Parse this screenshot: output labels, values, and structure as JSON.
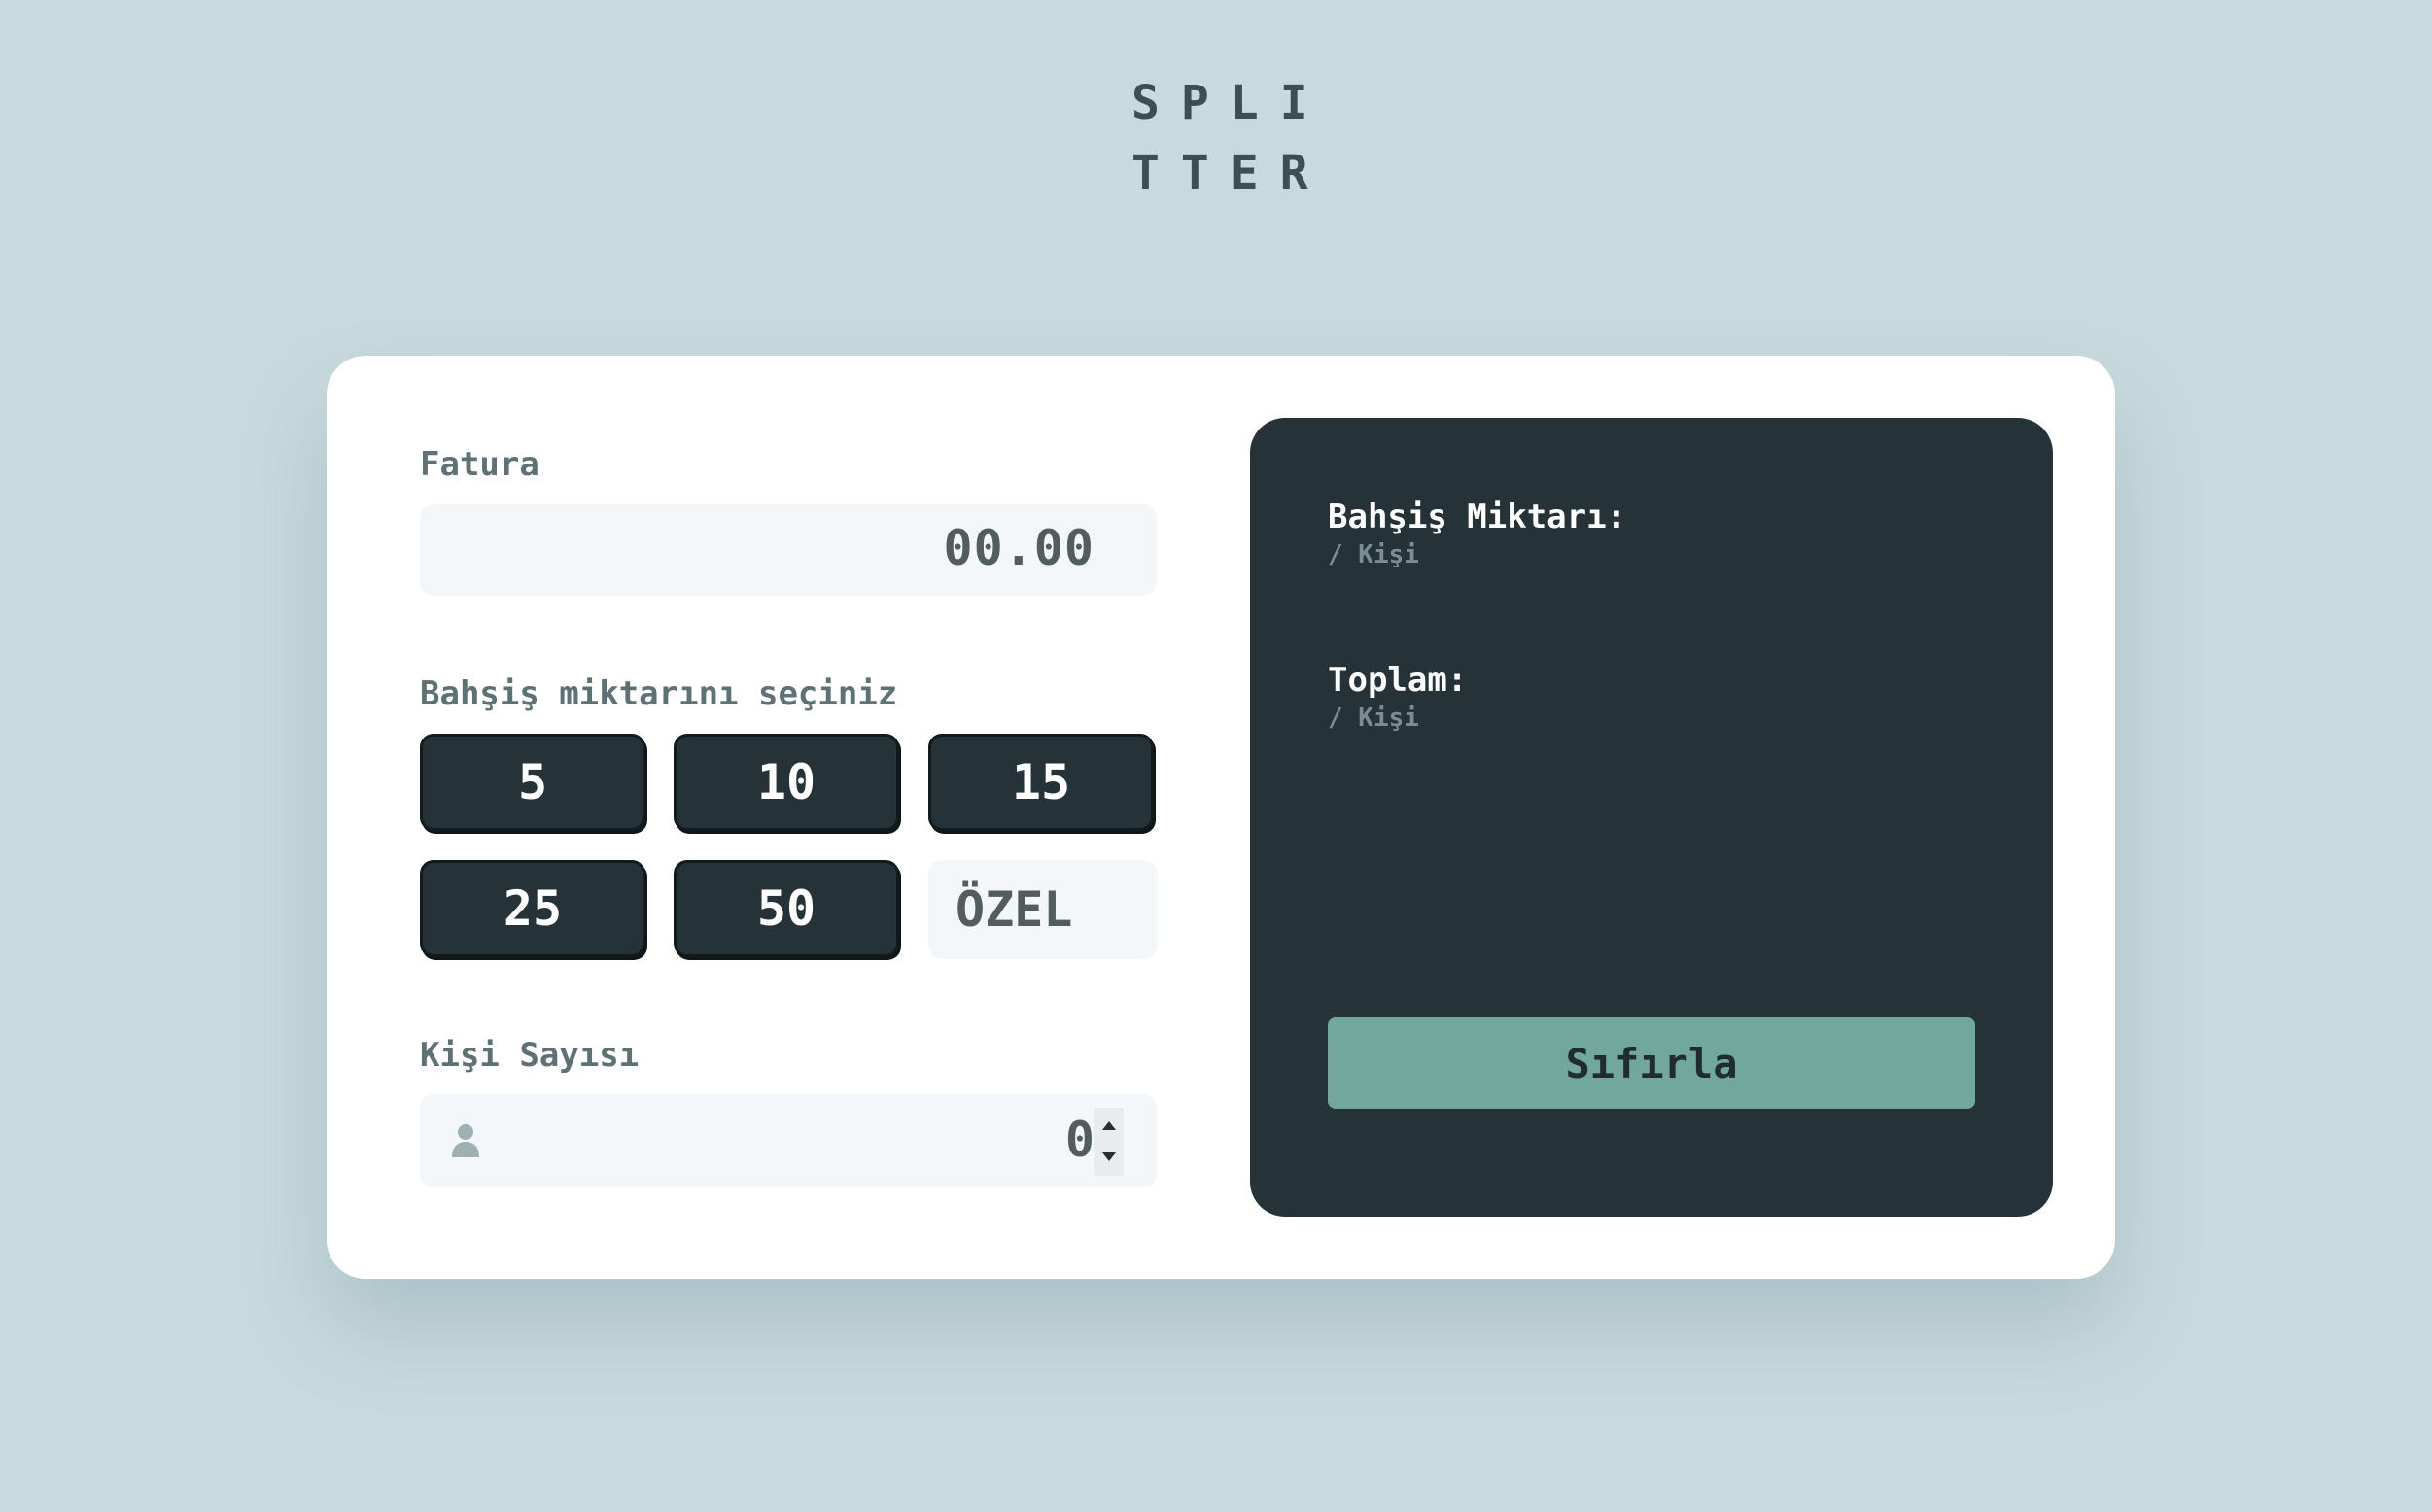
{
  "logo": {
    "line1": "SPLI",
    "line2": "TTER"
  },
  "bill": {
    "label": "Fatura",
    "value": "00.00"
  },
  "tip": {
    "label": "Bahşiş miktarını seçiniz",
    "options": [
      "5",
      "10",
      "15",
      "25",
      "50"
    ],
    "custom_placeholder": "ÖZEL"
  },
  "people": {
    "label": "Kişi Sayısı",
    "value": "0",
    "icon": "person-icon"
  },
  "results": {
    "tip_amount_title": "Bahşiş Miktarı:",
    "tip_amount_sub": "/ Kişi",
    "total_title": "Toplam:",
    "total_sub": "/ Kişi",
    "reset_label": "Sıfırla"
  },
  "colors": {
    "background": "#c9dade",
    "card": "#ffffff",
    "dark": "#253338",
    "accent": "#72a89b",
    "input_bg": "#f3f7f9"
  }
}
